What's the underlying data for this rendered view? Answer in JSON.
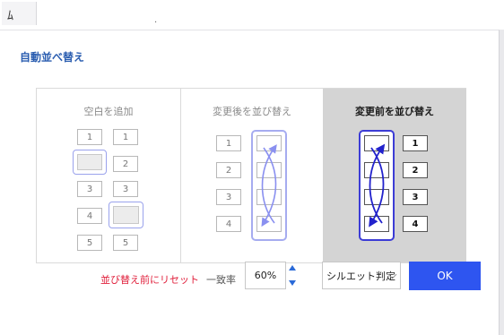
{
  "topbar": {
    "glyph": "ﾑ",
    "dot": "."
  },
  "dialog": {
    "title": "自動並べ替え",
    "panels": [
      {
        "title": "空白を追加",
        "state": "inactive",
        "left": [
          "1",
          "",
          "3",
          "4",
          "5"
        ],
        "right": [
          "1",
          "2",
          "3",
          "",
          "5"
        ]
      },
      {
        "title": "変更後を並び替え",
        "state": "inactive",
        "numbers": [
          "1",
          "2",
          "3",
          "4"
        ]
      },
      {
        "title": "変更前を並び替え",
        "state": "selected",
        "numbers": [
          "1",
          "2",
          "3",
          "4"
        ]
      }
    ],
    "reset_label": "並び替え前にリセット",
    "match_label": "一致率",
    "match_value": "60%",
    "select_value": "シルエット判定",
    "ok_label": "OK"
  },
  "colors": {
    "accent": "#2e55f0",
    "reset": "#e0203c",
    "title": "#2a5db0",
    "selected_bg": "#d4d4d4",
    "arrow_light": "#8a90f0",
    "arrow_dark": "#2222cc"
  },
  "icons": [
    "swap-arrows-icon",
    "spin-up-icon",
    "spin-down-icon",
    "chevron-down-icon"
  ]
}
